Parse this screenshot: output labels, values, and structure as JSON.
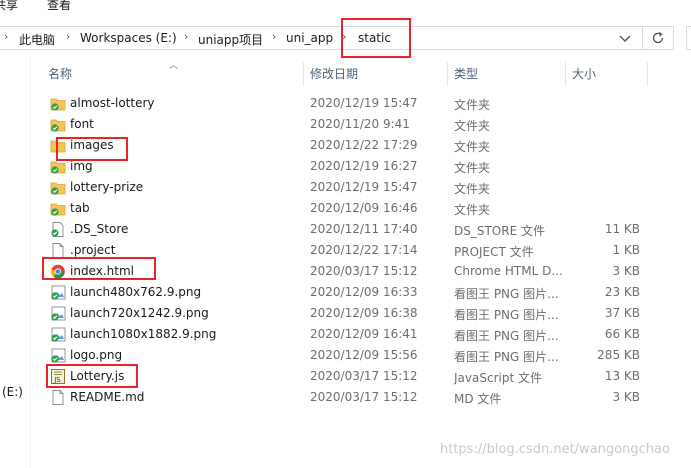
{
  "ribbon": {
    "tabs": [
      "共享",
      "查看"
    ]
  },
  "address": {
    "breadcrumbs": [
      "此电脑",
      "Workspaces (E:)",
      "uniapp项目",
      "uni_app",
      "static"
    ],
    "dropdown_icon": "chevron-down-icon",
    "refresh_icon": "refresh-icon"
  },
  "nav": {
    "drive_label": "(E:)"
  },
  "columns": {
    "name": "名称",
    "date": "修改日期",
    "type": "类型",
    "size": "大小"
  },
  "files": [
    {
      "name": "almost-lottery",
      "date": "2020/12/19 15:47",
      "type": "文件夹",
      "size": "",
      "icon": "folder-green-check-icon"
    },
    {
      "name": "font",
      "date": "2020/11/20 9:41",
      "type": "文件夹",
      "size": "",
      "icon": "folder-green-check-icon"
    },
    {
      "name": "images",
      "date": "2020/12/22 17:29",
      "type": "文件夹",
      "size": "",
      "icon": "folder-icon"
    },
    {
      "name": "img",
      "date": "2020/12/19 16:27",
      "type": "文件夹",
      "size": "",
      "icon": "folder-green-check-icon"
    },
    {
      "name": "lottery-prize",
      "date": "2020/12/19 15:47",
      "type": "文件夹",
      "size": "",
      "icon": "folder-green-check-icon"
    },
    {
      "name": "tab",
      "date": "2020/12/09 16:46",
      "type": "文件夹",
      "size": "",
      "icon": "folder-green-check-icon"
    },
    {
      "name": ".DS_Store",
      "date": "2020/12/11 17:40",
      "type": "DS_STORE 文件",
      "size": "11 KB",
      "icon": "file-green-check-icon"
    },
    {
      "name": ".project",
      "date": "2020/12/22 17:14",
      "type": "PROJECT 文件",
      "size": "1 KB",
      "icon": "file-icon"
    },
    {
      "name": "index.html",
      "date": "2020/03/17 15:12",
      "type": "Chrome HTML D...",
      "size": "3 KB",
      "icon": "chrome-icon"
    },
    {
      "name": "launch480x762.9.png",
      "date": "2020/12/09 16:33",
      "type": "看图王 PNG 图片...",
      "size": "23 KB",
      "icon": "image-green-check-icon"
    },
    {
      "name": "launch720x1242.9.png",
      "date": "2020/12/09 16:38",
      "type": "看图王 PNG 图片...",
      "size": "37 KB",
      "icon": "image-green-check-icon"
    },
    {
      "name": "launch1080x1882.9.png",
      "date": "2020/12/09 16:41",
      "type": "看图王 PNG 图片...",
      "size": "66 KB",
      "icon": "image-green-check-icon"
    },
    {
      "name": "logo.png",
      "date": "2020/12/09 15:56",
      "type": "看图王 PNG 图片...",
      "size": "285 KB",
      "icon": "image-green-check-icon"
    },
    {
      "name": "Lottery.js",
      "date": "2020/03/17 15:12",
      "type": "JavaScript 文件",
      "size": "13 KB",
      "icon": "javascript-file-icon"
    },
    {
      "name": "README.md",
      "date": "2020/03/17 15:12",
      "type": "MD 文件",
      "size": "3 KB",
      "icon": "file-icon"
    }
  ],
  "watermark": "https://blog.csdn.net/wangongchao",
  "colors": {
    "highlight": "#e8242a",
    "folder": "#f4c455",
    "check": "#2ea043",
    "header_text": "#4c607a"
  }
}
